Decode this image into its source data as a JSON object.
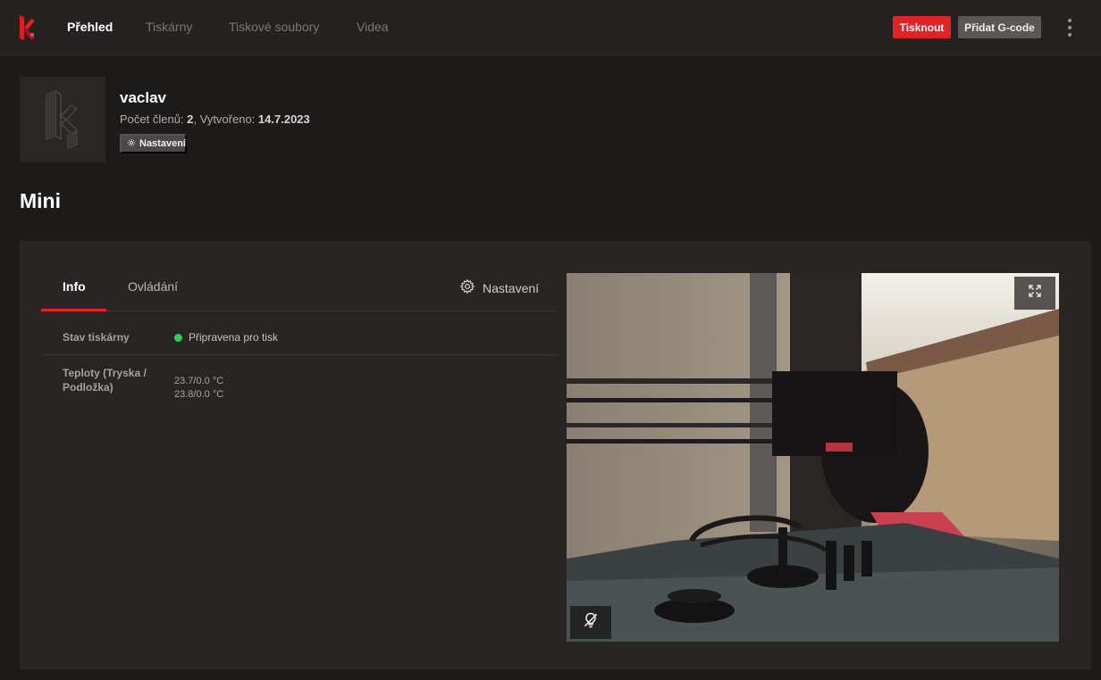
{
  "nav": {
    "items": [
      {
        "label": "Přehled",
        "active": true
      },
      {
        "label": "Tiskárny",
        "active": false
      },
      {
        "label": "Tiskové soubory",
        "active": false
      },
      {
        "label": "Videa",
        "active": false
      }
    ],
    "print_button": "Tisknout",
    "add_gcode_button": "Přidat G-code"
  },
  "group": {
    "name": "vaclav",
    "members_label": "Počet členů:",
    "members_count": "2",
    "created_label": ", Vytvořeno:",
    "created_date": "14.7.2023",
    "settings_button": "Nastavení"
  },
  "printer": {
    "title": "Mini",
    "tabs": [
      {
        "label": "Info",
        "active": true
      },
      {
        "label": "Ovládání",
        "active": false
      }
    ],
    "settings_label": "Nastavení",
    "status_label": "Stav tiskárny",
    "status_value": "Připravena pro tisk",
    "temps_label": "Teploty (Tryska / Podložka)",
    "temp_nozzle": "23.7/0.0 °C",
    "temp_bed": "23.8/0.0 °C"
  },
  "colors": {
    "accent": "#e32228",
    "status_ready": "#2ecc52",
    "background": "#1d1a1a",
    "card": "#292525"
  },
  "icons": {
    "logo": "brand-logo-icon",
    "group_logo": "group-logo-icon",
    "settings": "gear-icon",
    "more": "kebab-menu-icon",
    "fullscreen": "fullscreen-icon",
    "light_off": "light-off-icon"
  }
}
